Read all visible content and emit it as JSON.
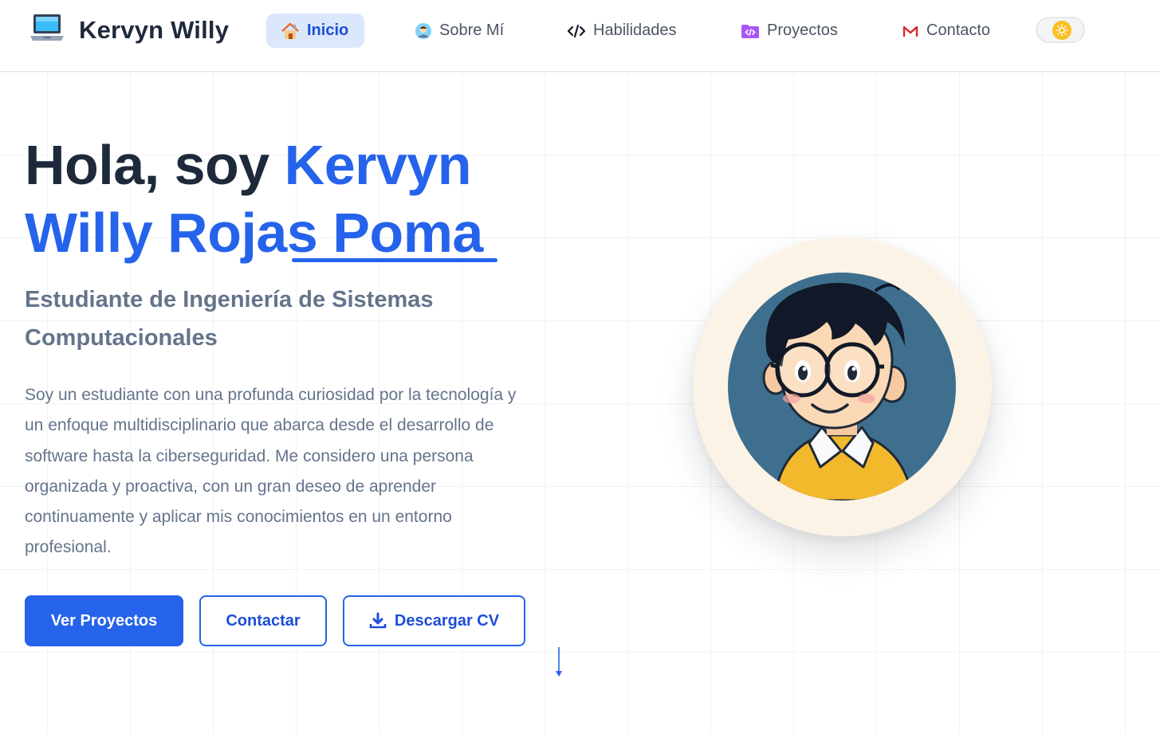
{
  "header": {
    "brand_name": "Kervyn Willy",
    "brand_icon": "laptop-icon",
    "nav": [
      {
        "label": "Inicio",
        "icon": "house-icon",
        "active": true
      },
      {
        "label": "Sobre Mí",
        "icon": "person-icon"
      },
      {
        "label": "Habilidades",
        "icon": "code-icon"
      },
      {
        "label": "Proyectos",
        "icon": "folder-code-icon"
      },
      {
        "label": "Contacto",
        "icon": "mail-icon"
      }
    ],
    "theme_toggle_icon": "sun-icon"
  },
  "hero": {
    "greeting": "Hola, soy ",
    "name_first": "Kervyn",
    "name_rest": "Willy Rojas Poma",
    "subtitle": "Estudiante de Ingeniería de Sistemas Computacionales",
    "description": "Soy un estudiante con una profunda curiosidad por la tecnología y un enfoque multidisciplinario que abarca desde el desarrollo de software hasta la ciberseguridad. Me considero una persona organizada y proactiva, con un gran deseo de aprender continuamente y aplicar mis conocimientos en un entorno profesional.",
    "buttons": {
      "projects": "Ver Proyectos",
      "contact": "Contactar",
      "cv": "Descargar CV"
    }
  },
  "colors": {
    "accent": "#2563eb",
    "heading": "#1e293b",
    "muted": "#64748b",
    "toggle_sun": "#fbbf24"
  }
}
